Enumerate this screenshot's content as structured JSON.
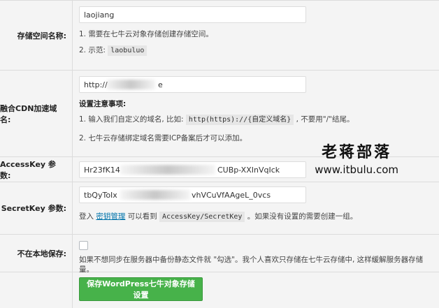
{
  "bucket": {
    "label": "存储空间名称:",
    "value": "laojiang",
    "note1": "1. 需要在七牛云对象存储创建存储空间。",
    "note2_prefix": "2. 示范:",
    "note2_code": "laobuluo"
  },
  "cdn": {
    "label": "融合CDN加速域名:",
    "value_prefix": "http://",
    "value_suffix": "e",
    "notes_title": "设置注意事项:",
    "note1_prefix": "1. 输入我们自定义的域名, 比如:",
    "note1_code": "http(https)://{自定义域名}",
    "note1_suffix": ", 不要用\"/\"结尾。",
    "note2": "2. 七牛云存储绑定域名需要ICP备案后才可以添加。"
  },
  "accesskey": {
    "label": "AccessKey 参数:",
    "value_prefix": "Hr23fK14",
    "value_suffix": "CUBp-XXInVqIck"
  },
  "secretkey": {
    "label": "SecretKey 参数:",
    "value_prefix": "tbQyToIx",
    "value_suffix": "vhVCuVfAAgeL_0vcs",
    "help_prefix": "登入",
    "help_link": "密钥管理",
    "help_mid": "可以看到",
    "help_code": "AccessKey/SecretKey",
    "help_suffix": "。如果没有设置的需要创建一组。"
  },
  "local": {
    "label": "不在本地保存:",
    "note": "如果不想同步在服务器中备份静态文件就 \"勾选\"。我个人喜欢只存储在七牛云存储中, 这样缓解服务器存储量。"
  },
  "submit_label": "保存WordPress七牛对象存储设置",
  "watermark": {
    "cn": "老蒋部落",
    "en": "www.itbulu.com"
  }
}
